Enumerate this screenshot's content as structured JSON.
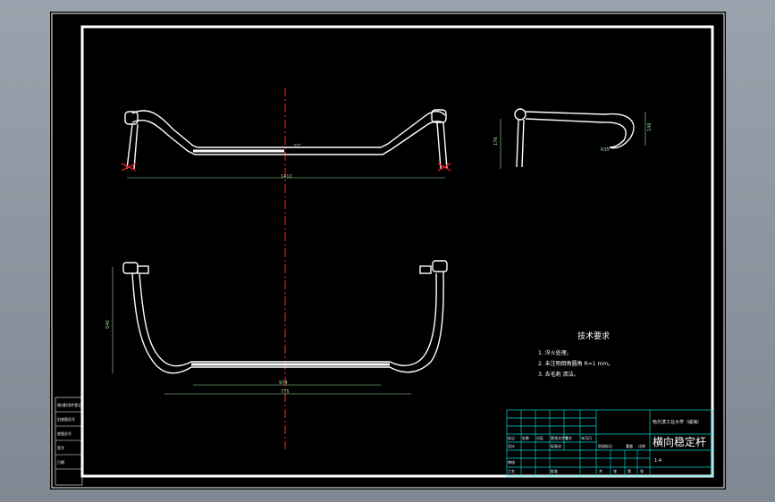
{
  "drawing": {
    "title": "横向稳定杆",
    "school": "哈尔滨工业大学（威海）"
  },
  "tech_requirements": {
    "heading": "技术要求",
    "items": [
      "1. 淬火处理。",
      "2. 未注明倒角圆角 R=1 mm。",
      "3. 去毛刺 清洁。"
    ]
  },
  "dimensions": {
    "front_overall": "1412",
    "front_angle": "27°",
    "side_height": "176",
    "side_width": "146",
    "side_radius": "R35",
    "top_overall": "775",
    "top_inner": "974",
    "top_depth": "540"
  },
  "left_stamp": [
    "借(通)用件登记",
    "旧底图总号",
    "底图总号",
    "签字",
    "日期"
  ],
  "title_block": {
    "scale": "1:4",
    "headers": [
      "标记",
      "处数",
      "分区",
      "更改文件号",
      "签名",
      "年月日"
    ],
    "rows": [
      "设计",
      "审核",
      "工艺",
      "批准"
    ],
    "fields": [
      "标准化",
      "阶段标记",
      "重量",
      "比例"
    ],
    "sheet_labels": [
      "共",
      "张",
      "第",
      "张"
    ]
  },
  "colors": {
    "background": "#000000",
    "border": "#ffffff",
    "centerline": "#e31b1b",
    "dimension": "#9fe3a0",
    "title_grid": "#00d4d4"
  }
}
